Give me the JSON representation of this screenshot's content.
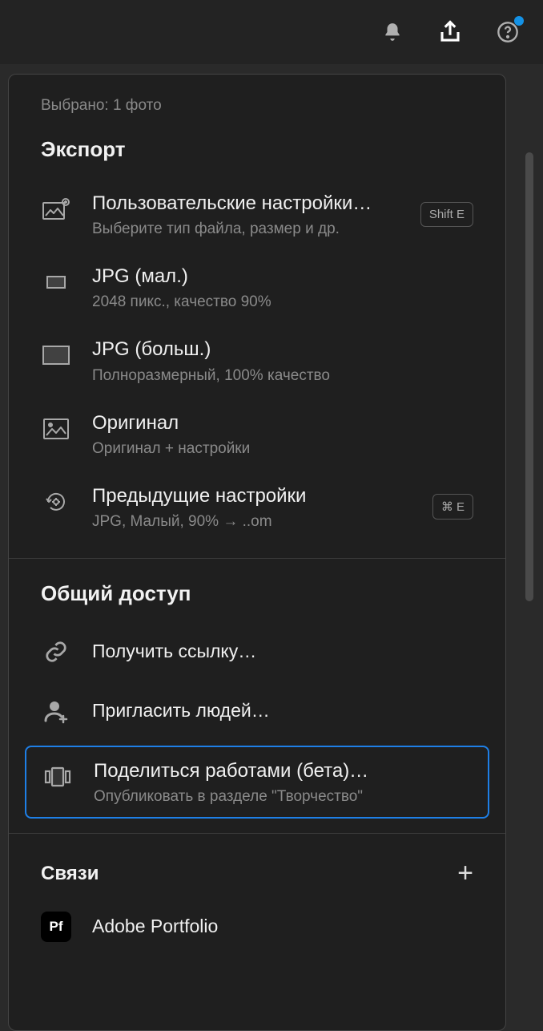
{
  "topbar": {
    "notifications_icon": "bell-icon",
    "share_icon": "share-icon",
    "help_icon": "help-icon"
  },
  "panel": {
    "selected_text": "Выбрано: 1 фото",
    "export_title": "Экспорт",
    "items": {
      "custom": {
        "title": "Пользовательские настройки…",
        "sub": "Выберите тип файла, размер и др.",
        "shortcut": "Shift E"
      },
      "jpg_small": {
        "title": "JPG (мал.)",
        "sub": "2048 пикс., качество 90%"
      },
      "jpg_large": {
        "title": "JPG (больш.)",
        "sub": "Полноразмерный, 100% качество"
      },
      "original": {
        "title": "Оригинал",
        "sub": "Оригинал + настройки"
      },
      "previous": {
        "title": "Предыдущие настройки",
        "sub": "JPG, Малый, 90% → ..om",
        "shortcut": "⌘ E"
      }
    },
    "share_title": "Общий доступ",
    "share_items": {
      "get_link": {
        "title": "Получить ссылку…"
      },
      "invite": {
        "title": "Пригласить людей…"
      },
      "share_work": {
        "title": "Поделиться работами (бета)…",
        "sub": "Опубликовать в разделе \"Творчество\""
      }
    },
    "connections_title": "Связи",
    "connections": {
      "portfolio": {
        "title": "Adobe Portfolio",
        "badge": "Pf"
      }
    }
  }
}
